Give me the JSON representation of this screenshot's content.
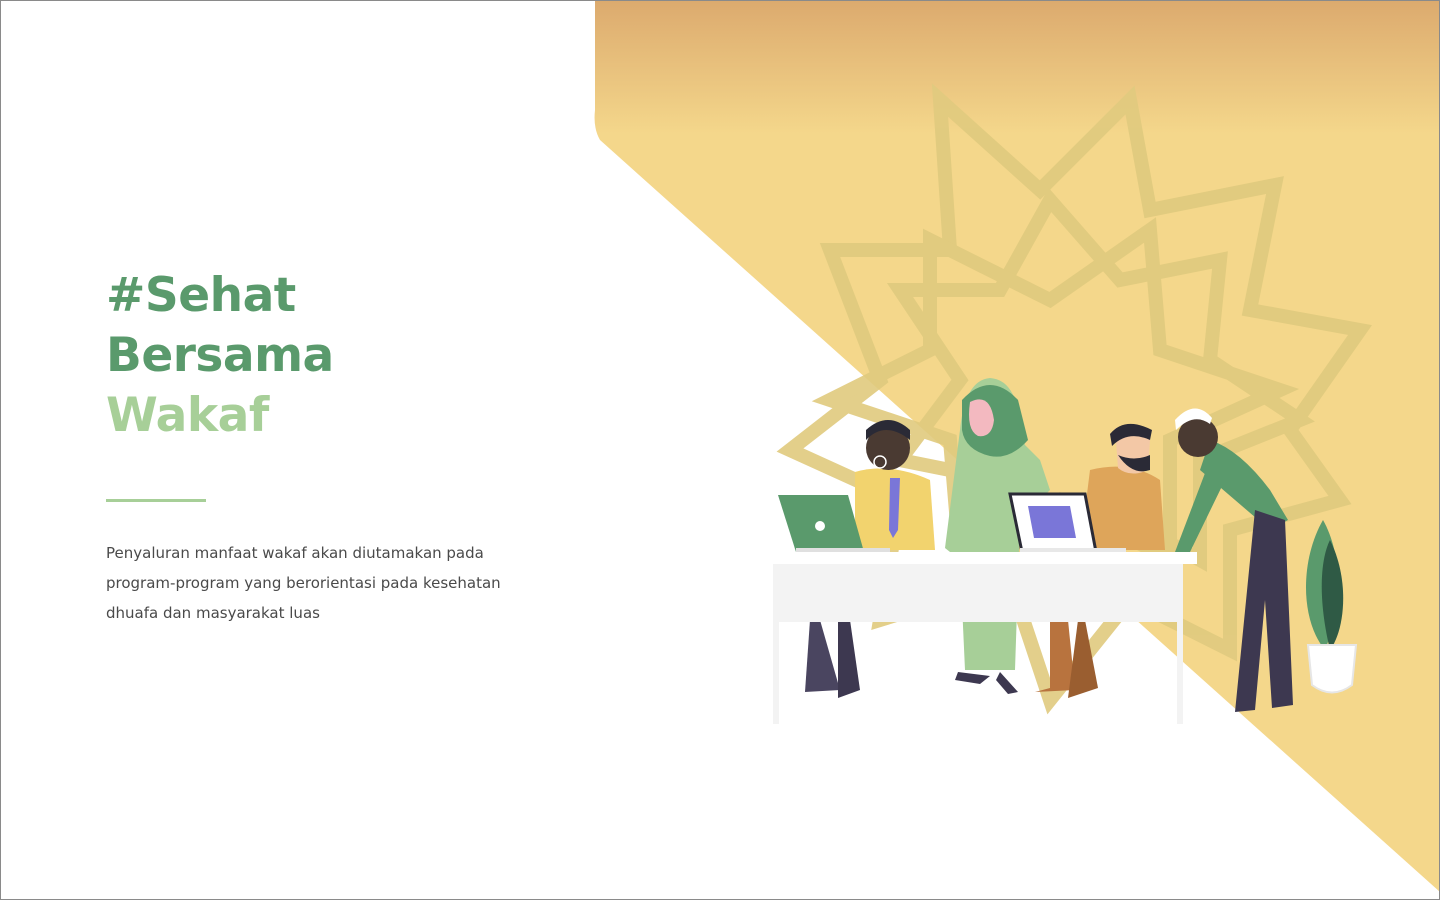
{
  "hero": {
    "title_line1": "#Sehat",
    "title_line2": "Bersama",
    "title_line3": "Wakaf",
    "description": "Penyaluran manfaat wakaf akan diutamakan pada program-program yang berorientasi pada kesehatan dhuafa dan masyarakat luas"
  },
  "colors": {
    "accent_dark": "#5a9a6c",
    "accent_light": "#a7cf98",
    "background_gold": "#f4d78b"
  },
  "illustration": {
    "icon": "team-working-illustration",
    "pattern": "islamic-star-pattern"
  }
}
